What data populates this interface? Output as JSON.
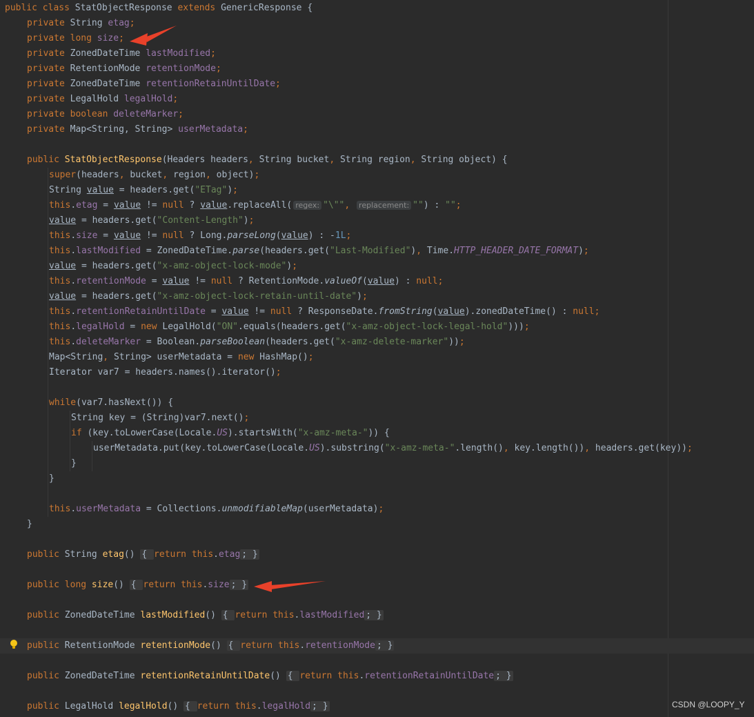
{
  "watermark": "CSDN @LOOPY_Y",
  "colors": {
    "background": "#2b2b2b",
    "keyword": "#cc7832",
    "string": "#6a8759",
    "number": "#6897bb",
    "field": "#9876aa",
    "method_declaration": "#ffc66d",
    "default_text": "#a9b7c6",
    "annotation_arrow": "#e8412a"
  },
  "icons": [
    "intention-bulb-icon",
    "red-arrow-annotation"
  ],
  "code_lines": [
    {
      "tokens": [
        [
          "kw",
          "public class "
        ],
        [
          "p",
          "StatObjectResponse "
        ],
        [
          "kw",
          "extends "
        ],
        [
          "p",
          "GenericResponse {"
        ]
      ]
    },
    {
      "indent": 1,
      "tokens": [
        [
          "kw",
          "private "
        ],
        [
          "p",
          "String "
        ],
        [
          "field",
          "etag"
        ],
        [
          "kw",
          ";"
        ]
      ]
    },
    {
      "indent": 1,
      "tokens": [
        [
          "kw",
          "private long "
        ],
        [
          "field",
          "size"
        ],
        [
          "kw",
          ";"
        ]
      ]
    },
    {
      "indent": 1,
      "tokens": [
        [
          "kw",
          "private "
        ],
        [
          "p",
          "ZonedDateTime "
        ],
        [
          "field",
          "lastModified"
        ],
        [
          "kw",
          ";"
        ]
      ]
    },
    {
      "indent": 1,
      "tokens": [
        [
          "kw",
          "private "
        ],
        [
          "p",
          "RetentionMode "
        ],
        [
          "field",
          "retentionMode"
        ],
        [
          "kw",
          ";"
        ]
      ]
    },
    {
      "indent": 1,
      "tokens": [
        [
          "kw",
          "private "
        ],
        [
          "p",
          "ZonedDateTime "
        ],
        [
          "field",
          "retentionRetainUntilDate"
        ],
        [
          "kw",
          ";"
        ]
      ]
    },
    {
      "indent": 1,
      "tokens": [
        [
          "kw",
          "private "
        ],
        [
          "p",
          "LegalHold "
        ],
        [
          "field",
          "legalHold"
        ],
        [
          "kw",
          ";"
        ]
      ]
    },
    {
      "indent": 1,
      "tokens": [
        [
          "kw",
          "private boolean "
        ],
        [
          "field",
          "deleteMarker"
        ],
        [
          "kw",
          ";"
        ]
      ]
    },
    {
      "indent": 1,
      "tokens": [
        [
          "kw",
          "private "
        ],
        [
          "p",
          "Map<String, String> "
        ],
        [
          "field",
          "userMetadata"
        ],
        [
          "kw",
          ";"
        ]
      ]
    },
    {
      "tokens": []
    },
    {
      "indent": 1,
      "tokens": [
        [
          "kw",
          "public "
        ],
        [
          "fn",
          "StatObjectResponse"
        ],
        [
          "p",
          "(Headers headers"
        ],
        [
          "kw",
          ", "
        ],
        [
          "p",
          "String bucket"
        ],
        [
          "kw",
          ", "
        ],
        [
          "p",
          "String region"
        ],
        [
          "kw",
          ", "
        ],
        [
          "p",
          "String object) {"
        ]
      ]
    },
    {
      "indent": 2,
      "tokens": [
        [
          "kw",
          "super"
        ],
        [
          "p",
          "(headers"
        ],
        [
          "kw",
          ", "
        ],
        [
          "p",
          "bucket"
        ],
        [
          "kw",
          ", "
        ],
        [
          "p",
          "region"
        ],
        [
          "kw",
          ", "
        ],
        [
          "p",
          "object)"
        ],
        [
          "kw",
          ";"
        ]
      ]
    },
    {
      "indent": 2,
      "tokens": [
        [
          "p",
          "String "
        ],
        [
          "uvar",
          "value"
        ],
        [
          "p",
          " = headers.get("
        ],
        [
          "str",
          "\"ETag\""
        ],
        [
          "p",
          ")"
        ],
        [
          "kw",
          ";"
        ]
      ]
    },
    {
      "indent": 2,
      "tokens": [
        [
          "kw",
          "this"
        ],
        [
          "p",
          "."
        ],
        [
          "field",
          "etag"
        ],
        [
          "p",
          " = "
        ],
        [
          "uvar",
          "value"
        ],
        [
          "p",
          " != "
        ],
        [
          "kw",
          "null "
        ],
        [
          "p",
          "? "
        ],
        [
          "uvar",
          "value"
        ],
        [
          "p",
          ".replaceAll("
        ],
        [
          "hint",
          "regex:"
        ],
        [
          "str",
          "\"\\\"\""
        ],
        [
          "kw",
          ", "
        ],
        [
          "hint",
          "replacement:"
        ],
        [
          "str",
          "\"\""
        ],
        [
          "p",
          ") : "
        ],
        [
          "str",
          "\"\""
        ],
        [
          "kw",
          ";"
        ]
      ]
    },
    {
      "indent": 2,
      "tokens": [
        [
          "uvar",
          "value"
        ],
        [
          "p",
          " = headers.get("
        ],
        [
          "str",
          "\"Content-Length\""
        ],
        [
          "p",
          ")"
        ],
        [
          "kw",
          ";"
        ]
      ]
    },
    {
      "indent": 2,
      "tokens": [
        [
          "kw",
          "this"
        ],
        [
          "p",
          "."
        ],
        [
          "field",
          "size"
        ],
        [
          "p",
          " = "
        ],
        [
          "uvar",
          "value"
        ],
        [
          "p",
          " != "
        ],
        [
          "kw",
          "null "
        ],
        [
          "p",
          "? Long."
        ],
        [
          "italic",
          "parseLong"
        ],
        [
          "p",
          "("
        ],
        [
          "uvar",
          "value"
        ],
        [
          "p",
          ") : -"
        ],
        [
          "num",
          "1L"
        ],
        [
          "kw",
          ";"
        ]
      ]
    },
    {
      "indent": 2,
      "tokens": [
        [
          "kw",
          "this"
        ],
        [
          "p",
          "."
        ],
        [
          "field",
          "lastModified"
        ],
        [
          "p",
          " = ZonedDateTime."
        ],
        [
          "italic",
          "parse"
        ],
        [
          "p",
          "(headers.get("
        ],
        [
          "str",
          "\"Last-Modified\""
        ],
        [
          "p",
          ")"
        ],
        [
          "kw",
          ", "
        ],
        [
          "p",
          "Time."
        ],
        [
          "static",
          "HTTP_HEADER_DATE_FORMAT"
        ],
        [
          "p",
          ")"
        ],
        [
          "kw",
          ";"
        ]
      ]
    },
    {
      "indent": 2,
      "tokens": [
        [
          "uvar",
          "value"
        ],
        [
          "p",
          " = headers.get("
        ],
        [
          "str",
          "\"x-amz-object-lock-mode\""
        ],
        [
          "p",
          ")"
        ],
        [
          "kw",
          ";"
        ]
      ]
    },
    {
      "indent": 2,
      "tokens": [
        [
          "kw",
          "this"
        ],
        [
          "p",
          "."
        ],
        [
          "field",
          "retentionMode"
        ],
        [
          "p",
          " = "
        ],
        [
          "uvar",
          "value"
        ],
        [
          "p",
          " != "
        ],
        [
          "kw",
          "null "
        ],
        [
          "p",
          "? RetentionMode."
        ],
        [
          "italic",
          "valueOf"
        ],
        [
          "p",
          "("
        ],
        [
          "uvar",
          "value"
        ],
        [
          "p",
          ") : "
        ],
        [
          "kw",
          "null;"
        ]
      ]
    },
    {
      "indent": 2,
      "tokens": [
        [
          "uvar",
          "value"
        ],
        [
          "p",
          " = headers.get("
        ],
        [
          "str",
          "\"x-amz-object-lock-retain-until-date\""
        ],
        [
          "p",
          ")"
        ],
        [
          "kw",
          ";"
        ]
      ]
    },
    {
      "indent": 2,
      "tokens": [
        [
          "kw",
          "this"
        ],
        [
          "p",
          "."
        ],
        [
          "field",
          "retentionRetainUntilDate"
        ],
        [
          "p",
          " = "
        ],
        [
          "uvar",
          "value"
        ],
        [
          "p",
          " != "
        ],
        [
          "kw",
          "null "
        ],
        [
          "p",
          "? ResponseDate."
        ],
        [
          "italic",
          "fromString"
        ],
        [
          "p",
          "("
        ],
        [
          "uvar",
          "value"
        ],
        [
          "p",
          ").zonedDateTime() : "
        ],
        [
          "kw",
          "null;"
        ]
      ]
    },
    {
      "indent": 2,
      "tokens": [
        [
          "kw",
          "this"
        ],
        [
          "p",
          "."
        ],
        [
          "field",
          "legalHold"
        ],
        [
          "p",
          " = "
        ],
        [
          "kw",
          "new "
        ],
        [
          "p",
          "LegalHold("
        ],
        [
          "str",
          "\"ON\""
        ],
        [
          "p",
          ".equals(headers.get("
        ],
        [
          "str",
          "\"x-amz-object-lock-legal-hold\""
        ],
        [
          "p",
          ")))"
        ],
        [
          "kw",
          ";"
        ]
      ]
    },
    {
      "indent": 2,
      "tokens": [
        [
          "kw",
          "this"
        ],
        [
          "p",
          "."
        ],
        [
          "field",
          "deleteMarker"
        ],
        [
          "p",
          " = Boolean."
        ],
        [
          "italic",
          "parseBoolean"
        ],
        [
          "p",
          "(headers.get("
        ],
        [
          "str",
          "\"x-amz-delete-marker\""
        ],
        [
          "p",
          "))"
        ],
        [
          "kw",
          ";"
        ]
      ]
    },
    {
      "indent": 2,
      "tokens": [
        [
          "p",
          "Map<String"
        ],
        [
          "kw",
          ", "
        ],
        [
          "p",
          "String> userMetadata = "
        ],
        [
          "kw",
          "new "
        ],
        [
          "p",
          "HashMap()"
        ],
        [
          "kw",
          ";"
        ]
      ]
    },
    {
      "indent": 2,
      "tokens": [
        [
          "p",
          "Iterator var7 = headers.names().iterator()"
        ],
        [
          "kw",
          ";"
        ]
      ]
    },
    {
      "tokens": []
    },
    {
      "indent": 2,
      "tokens": [
        [
          "kw",
          "while"
        ],
        [
          "p",
          "(var7.hasNext()) {"
        ]
      ]
    },
    {
      "indent": 3,
      "tokens": [
        [
          "p",
          "String key = (String)var7.next()"
        ],
        [
          "kw",
          ";"
        ]
      ]
    },
    {
      "indent": 3,
      "tokens": [
        [
          "kw",
          "if "
        ],
        [
          "p",
          "(key.toLowerCase(Locale."
        ],
        [
          "static",
          "US"
        ],
        [
          "p",
          ").startsWith("
        ],
        [
          "str",
          "\"x-amz-meta-\""
        ],
        [
          "p",
          ")) {"
        ]
      ]
    },
    {
      "indent": 4,
      "tokens": [
        [
          "p",
          "userMetadata.put(key.toLowerCase(Locale."
        ],
        [
          "static",
          "US"
        ],
        [
          "p",
          ").substring("
        ],
        [
          "str",
          "\"x-amz-meta-\""
        ],
        [
          "p",
          ".length()"
        ],
        [
          "kw",
          ", "
        ],
        [
          "p",
          "key.length())"
        ],
        [
          "kw",
          ", "
        ],
        [
          "p",
          "headers.get(key))"
        ],
        [
          "kw",
          ";"
        ]
      ]
    },
    {
      "indent": 3,
      "tokens": [
        [
          "p",
          "}"
        ]
      ]
    },
    {
      "indent": 2,
      "tokens": [
        [
          "p",
          "}"
        ]
      ]
    },
    {
      "tokens": []
    },
    {
      "indent": 2,
      "tokens": [
        [
          "kw",
          "this"
        ],
        [
          "p",
          "."
        ],
        [
          "field",
          "userMetadata"
        ],
        [
          "p",
          " = Collections."
        ],
        [
          "italic",
          "unmodifiableMap"
        ],
        [
          "p",
          "(userMetadata)"
        ],
        [
          "kw",
          ";"
        ]
      ]
    },
    {
      "indent": 1,
      "tokens": [
        [
          "p",
          "}"
        ]
      ]
    },
    {
      "tokens": []
    },
    {
      "indent": 1,
      "tokens": [
        [
          "kw",
          "public "
        ],
        [
          "p",
          "String "
        ],
        [
          "fn",
          "etag"
        ],
        [
          "p",
          "() "
        ],
        [
          "fold",
          "{ "
        ],
        [
          "kw",
          "return this"
        ],
        [
          "p",
          "."
        ],
        [
          "field",
          "etag"
        ],
        [
          "fold",
          "; }"
        ]
      ]
    },
    {
      "tokens": []
    },
    {
      "indent": 1,
      "tokens": [
        [
          "kw",
          "public long "
        ],
        [
          "fn",
          "size"
        ],
        [
          "p",
          "() "
        ],
        [
          "fold",
          "{ "
        ],
        [
          "kw",
          "return this"
        ],
        [
          "p",
          "."
        ],
        [
          "field",
          "size"
        ],
        [
          "fold",
          "; }"
        ]
      ]
    },
    {
      "tokens": []
    },
    {
      "indent": 1,
      "tokens": [
        [
          "kw",
          "public "
        ],
        [
          "p",
          "ZonedDateTime "
        ],
        [
          "fn",
          "lastModified"
        ],
        [
          "p",
          "() "
        ],
        [
          "fold",
          "{ "
        ],
        [
          "kw",
          "return this"
        ],
        [
          "p",
          "."
        ],
        [
          "field",
          "lastModified"
        ],
        [
          "fold",
          "; }"
        ]
      ]
    },
    {
      "tokens": []
    },
    {
      "indent": 1,
      "current": true,
      "tokens": [
        [
          "kw",
          "public "
        ],
        [
          "p",
          "RetentionMode "
        ],
        [
          "fn",
          "retentionMode"
        ],
        [
          "p",
          "() "
        ],
        [
          "fold",
          "{ "
        ],
        [
          "kw",
          "return this"
        ],
        [
          "p",
          "."
        ],
        [
          "field",
          "retentionMode"
        ],
        [
          "fold",
          "; }"
        ]
      ]
    },
    {
      "tokens": []
    },
    {
      "indent": 1,
      "tokens": [
        [
          "kw",
          "public "
        ],
        [
          "p",
          "ZonedDateTime "
        ],
        [
          "fn",
          "retentionRetainUntilDate"
        ],
        [
          "p",
          "() "
        ],
        [
          "fold",
          "{ "
        ],
        [
          "kw",
          "return this"
        ],
        [
          "p",
          "."
        ],
        [
          "field",
          "retentionRetainUntilDate"
        ],
        [
          "fold",
          "; }"
        ]
      ]
    },
    {
      "tokens": []
    },
    {
      "indent": 1,
      "tokens": [
        [
          "kw",
          "public "
        ],
        [
          "p",
          "LegalHold "
        ],
        [
          "fn",
          "legalHold"
        ],
        [
          "p",
          "() "
        ],
        [
          "fold",
          "{ "
        ],
        [
          "kw",
          "return this"
        ],
        [
          "p",
          "."
        ],
        [
          "field",
          "legalHold"
        ],
        [
          "fold",
          "; }"
        ]
      ]
    }
  ]
}
